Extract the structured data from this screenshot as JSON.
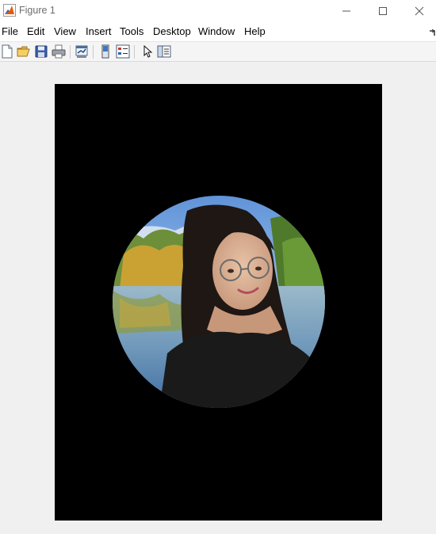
{
  "window": {
    "title": "Figure 1",
    "controls": [
      "minimize-icon",
      "maximize-icon",
      "close-icon"
    ]
  },
  "menu": {
    "items": [
      "File",
      "Edit",
      "View",
      "Insert",
      "Tools",
      "Desktop",
      "Window",
      "Help"
    ]
  },
  "toolbar": {
    "buttons": [
      "new-figure-icon",
      "open-file-icon",
      "save-icon",
      "print-icon",
      "link-plot-icon",
      "colorbar-icon",
      "legend-icon",
      "edit-plot-arrow-icon",
      "property-inspector-icon"
    ]
  },
  "figure": {
    "background_color": "#000000",
    "image_description_shape": "circle",
    "image_icon": "circular-portrait-photo"
  }
}
